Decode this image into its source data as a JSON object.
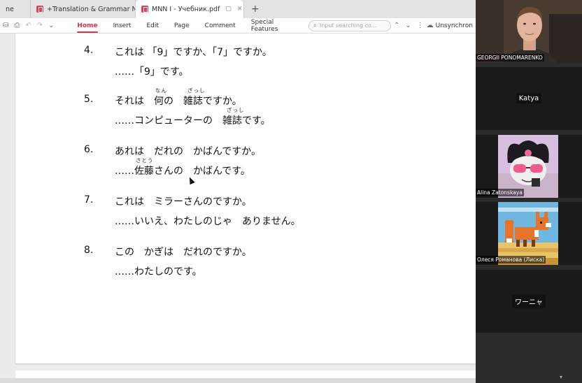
{
  "tabs": [
    {
      "label": "ne",
      "active": false
    },
    {
      "label": "+Translation & Grammar Notes I",
      "active": false
    },
    {
      "label": "MNN I - Учебник.pdf",
      "active": true
    }
  ],
  "toolbar": {
    "menus": [
      "Home",
      "Insert",
      "Edit",
      "Page",
      "Comment",
      "Special Features"
    ],
    "active_menu": "Home",
    "search_placeholder": "Input searching co...",
    "sync_label": "Unsynchron"
  },
  "questions": [
    {
      "num": "4.",
      "line1": "これは 「9」ですか、「7」ですか。",
      "line2": "……「9」です。",
      "ruby": []
    },
    {
      "num": "5.",
      "line1": "それは　何の　雑誌ですか。",
      "line2": "……コンピューターの　雑誌です。",
      "ruby": [
        "なん",
        "ざっし",
        "ざっし"
      ]
    },
    {
      "num": "6.",
      "line1": "あれは　だれの　かばんですか。",
      "line2": "……佐藤さんの　かばんです。",
      "ruby": [
        "さとう"
      ]
    },
    {
      "num": "7.",
      "line1": "これは　ミラーさんのですか。",
      "line2": "……いいえ、わたしのじゃ　ありません。",
      "ruby": []
    },
    {
      "num": "8.",
      "line1": "この　かぎは　だれのですか。",
      "line2": "……わたしのです。",
      "ruby": []
    }
  ],
  "participants": [
    {
      "name": "GEORGII PONOMARENKO",
      "video": true
    },
    {
      "name": "Katya",
      "video": false
    },
    {
      "name": "Alina Zatonskaya",
      "video": true
    },
    {
      "name": "Олеся Романова (Лиска)",
      "video": true
    },
    {
      "name": "ワーニャ",
      "video": false
    }
  ],
  "colors": {
    "accent": "#d9334f",
    "pdf_icon": "#e0405a"
  }
}
